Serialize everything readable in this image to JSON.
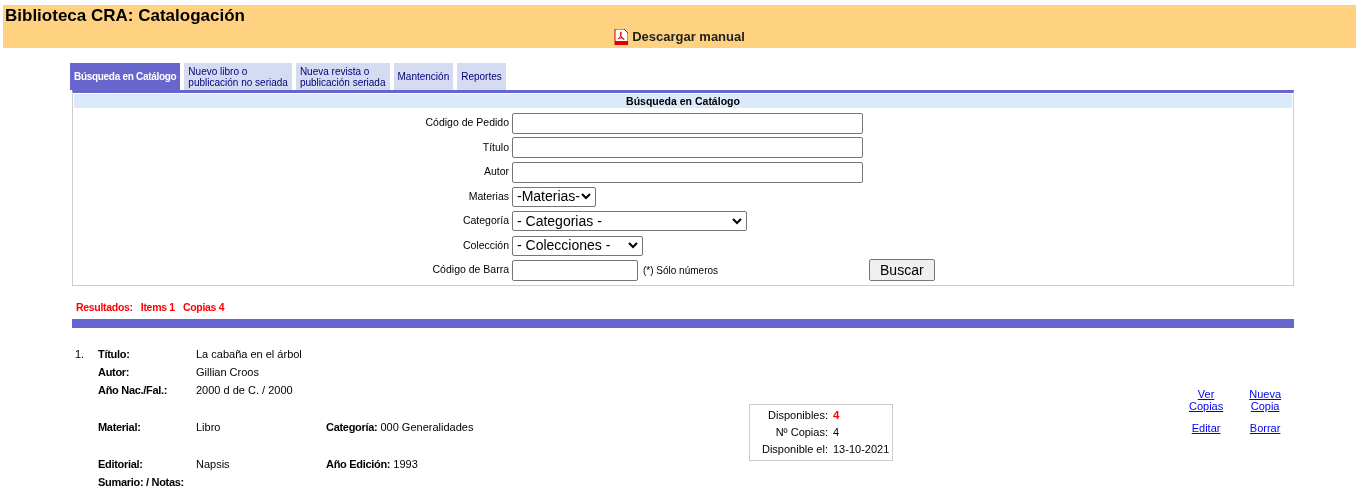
{
  "header": {
    "title": "Biblioteca CRA: Catalogación",
    "manual_link": "Descargar manual"
  },
  "tabs": [
    {
      "label": "Búsqueda en Catálogo",
      "selected": true
    },
    {
      "label": "Nuevo libro o\npublicación no seriada",
      "selected": false
    },
    {
      "label": "Nueva revista o\npublicación seriada",
      "selected": false
    },
    {
      "label": "Mantención",
      "selected": false
    },
    {
      "label": "Reportes",
      "selected": false
    }
  ],
  "search_panel": {
    "title": "Búsqueda en Catálogo",
    "fields": [
      {
        "label": "Código de Pedido",
        "kind": "text"
      },
      {
        "label": "Título",
        "kind": "text"
      },
      {
        "label": "Autor",
        "kind": "text"
      },
      {
        "label": "Materias",
        "kind": "select",
        "value": "-Materias-"
      },
      {
        "label": "Categoría",
        "kind": "select",
        "value": "- Categorias -"
      },
      {
        "label": "Colección",
        "kind": "select",
        "value": "- Colecciones -"
      },
      {
        "label": "Código de Barra",
        "kind": "text",
        "note": "(*) Sólo números"
      }
    ],
    "button": "Buscar"
  },
  "results": {
    "label": "Resultados:",
    "items": "Items 1",
    "copies": "Copias 4"
  },
  "records": [
    {
      "number": "1.",
      "sections": [
        [
          {
            "label": "Título:",
            "value": "La cabaña en el árbol"
          },
          {
            "label": "Autor:",
            "value": "Gillian Croos"
          },
          {
            "label": "Año Nac./Fal.:",
            "value": "2000 d de C. / 2000"
          }
        ],
        [
          {
            "label": "Material:",
            "value": "Libro",
            "extra_label": "Categoría:",
            "extra_value": "000 Generalidades"
          }
        ],
        [
          {
            "label": "Editorial:",
            "value": "Napsis",
            "extra_label": "Año Edición:",
            "extra_value": "1993"
          },
          {
            "label": "Sumario: / Notas:"
          }
        ]
      ],
      "availability": [
        {
          "label": "Disponibles:",
          "value": "4",
          "emphasis": true
        },
        {
          "label": "Nº Copias:",
          "value": "4",
          "emphasis": false
        },
        {
          "label": "Disponible el:",
          "value": "13-10-2021",
          "emphasis": false
        }
      ],
      "actions": [
        "Ver\nCopias",
        "Nueva\nCopia",
        "Editar",
        "Borrar"
      ]
    }
  ]
}
